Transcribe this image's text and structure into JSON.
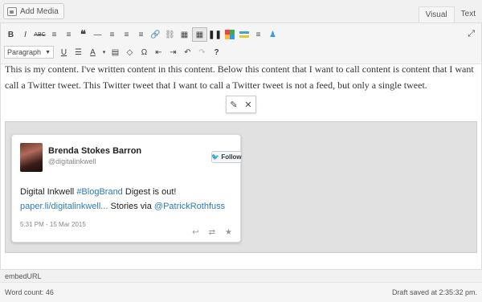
{
  "top": {
    "add_media_label": "Add Media",
    "tab_visual": "Visual",
    "tab_text": "Text"
  },
  "toolbar": {
    "row1": [
      "B",
      "I",
      "ABC",
      "≡",
      "≡",
      "❝",
      "—",
      "≡",
      "≡",
      "≡",
      "🔗",
      "⛓",
      "▦",
      "▦",
      "❚❚",
      "▣",
      "▬",
      "≡",
      "♟"
    ],
    "format_select": "Paragraph",
    "row2": [
      "U",
      "☰",
      "A",
      "▾",
      "▤",
      "◇",
      "Ω",
      "⇤",
      "⇥",
      "↶",
      "↷",
      "?"
    ]
  },
  "content": {
    "paragraph": "This is my content. I've written content in this content. Below this content that I want to call content is content that I want call a Twitter tweet. This Twitter tweet that I want to call a Twitter tweet is not a                    feed, but only a single tweet."
  },
  "tweet": {
    "name": "Brenda Stokes Barron",
    "handle": "@digitalinkwell",
    "follow_label": "Follow",
    "text_before": "Digital Inkwell ",
    "hashtag": "#BlogBrand",
    "text_mid": " Digest is out!",
    "link": "paper.li/digitalinkwell...",
    "text_after": " Stories via ",
    "mention": "@PatrickRothfuss",
    "date": "5:31 PM - 15 Mar 2015"
  },
  "tag_label": "embedURL",
  "status": {
    "word_count": "Word count: 46",
    "draft_saved": "Draft saved at 2:35:32 pm."
  }
}
